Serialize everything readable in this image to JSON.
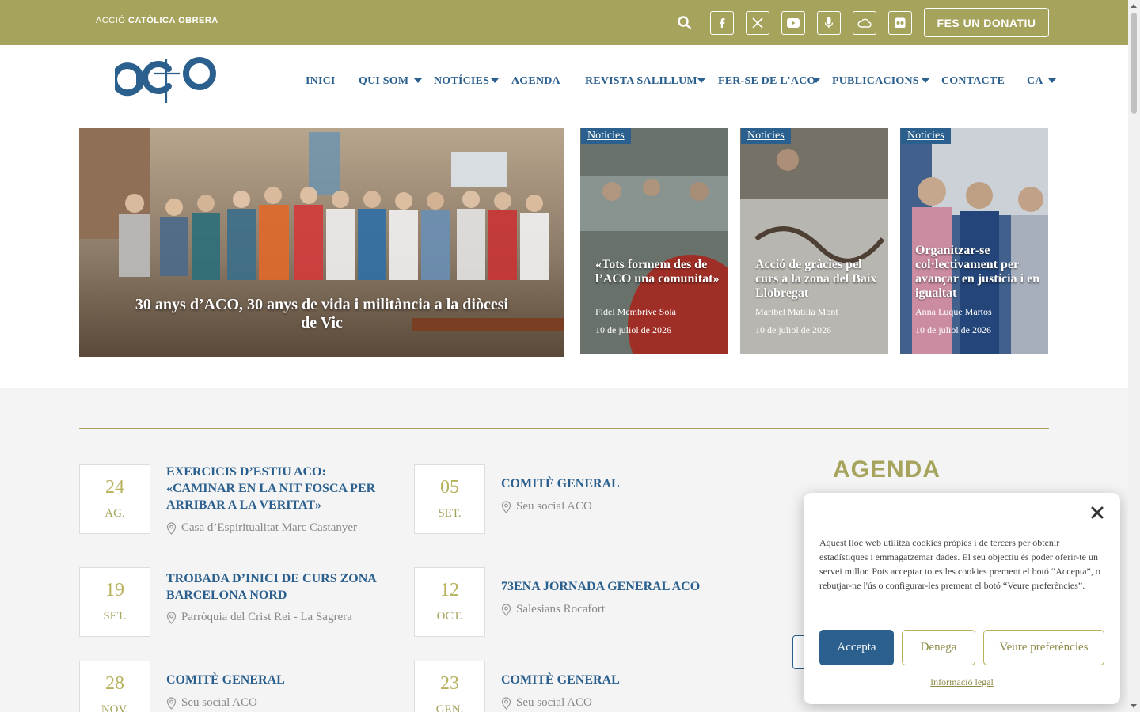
{
  "topbar": {
    "brand_light": "ACCIÓ ",
    "brand_bold": "CATÒLICA OBRERA",
    "donate_label": "FES UN DONATIU",
    "social": [
      "facebook-icon",
      "x-icon",
      "youtube-icon",
      "microphone-icon",
      "cloud-icon",
      "flickr-icon"
    ],
    "accent_color": "#a6a45c"
  },
  "nav": {
    "items": [
      "INICI",
      "QUI SOM",
      "NOTÍCIES",
      "AGENDA",
      "REVISTA SALILLUM",
      "FER-SE DE L'ACO",
      "PUBLICACIONS",
      "CONTACTE",
      "CA"
    ],
    "link_color": "#2a5f8e"
  },
  "hero": {
    "main_title": "30 anys d’ACO, 30 anys de vida i militància a la diòcesi de Vic",
    "cards": [
      {
        "tag": "Notícies",
        "title": "«Tots formem des de l’ACO una comunitat»",
        "author": "Fidel Membrive Solà",
        "date": "10 de juliol de 2026"
      },
      {
        "tag": "Notícies",
        "title": "Acció de gràcies pel curs a la zona del Baix Llobregat",
        "author": "Maribel Matilla Mont",
        "date": "10 de juliol de 2026"
      },
      {
        "tag": "Notícies",
        "title": "Organitzar-se col·lectivament per avançar en justícia i en igualtat",
        "author": "Anna Luque Martos",
        "date": "10 de juliol de 2026"
      }
    ]
  },
  "events": [
    {
      "day": "24",
      "month": "AG.",
      "title": "EXERCICIS D’ESTIU ACO: «CAMINAR EN LA NIT FOSCA PER ARRIBAR A LA VERITAT»",
      "location": "Casa d’Espiritualitat Marc Castanyer"
    },
    {
      "day": "05",
      "month": "SET.",
      "title": "COMITÈ GENERAL",
      "location": "Seu social ACO"
    },
    {
      "day": "19",
      "month": "SET.",
      "title": "TROBADA D’INICI DE CURS ZONA BARCELONA NORD",
      "location": "Parròquia del Crist Rei - La Sagrera"
    },
    {
      "day": "12",
      "month": "OCT.",
      "title": "73ENA JORNADA GENERAL ACO",
      "location": "Salesians Rocafort"
    },
    {
      "day": "28",
      "month": "NOV.",
      "title": "COMITÈ GENERAL",
      "location": "Seu social ACO"
    },
    {
      "day": "23",
      "month": "GEN.",
      "title": "COMITÈ GENERAL",
      "location": "Seu social ACO"
    }
  ],
  "agenda": {
    "heading": "AGENDA"
  },
  "cookie": {
    "text": "Aquest lloc web utilitza cookies pròpies i de tercers per obtenir estadístiques i emmagatzemar dades. El seu objectiu és poder oferir-te un servei millor. Pots acceptar totes les cookies prement el botó “Accepta”, o rebutjar-ne l'ús o configurar-les prement el botó “Veure preferències”.",
    "accept": "Accepta",
    "deny": "Denega",
    "preferences": "Veure preferències",
    "legal": "Informació legal"
  }
}
